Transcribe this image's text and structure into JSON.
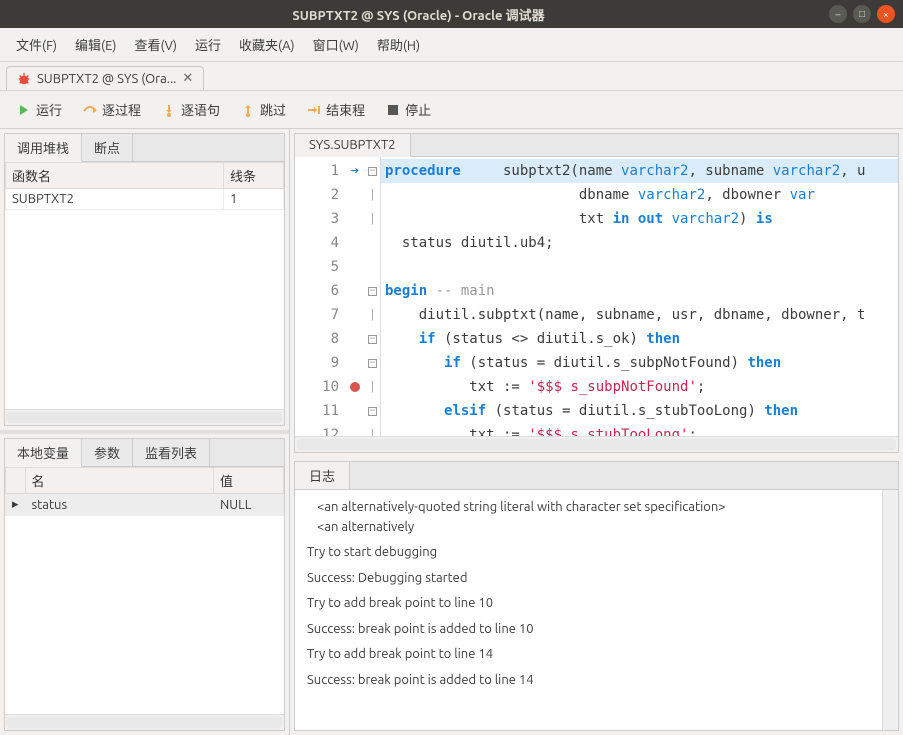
{
  "window": {
    "title": "SUBPTXT2 @ SYS (Oracle) - Oracle 调试器"
  },
  "menu": {
    "file": "文件(F)",
    "edit": "编辑(E)",
    "view": "查看(V)",
    "run": "运行",
    "bookmarks": "收藏夹(A)",
    "window": "窗口(W)",
    "help": "帮助(H)"
  },
  "doc_tab": {
    "label": "SUBPTXT2 @ SYS (Ora..."
  },
  "toolbar": {
    "run": "运行",
    "step_over": "逐过程",
    "step_into": "逐语句",
    "step_out": "跳过",
    "stop": "结束程",
    "pause": "停止"
  },
  "call_stack": {
    "tab_stack": "调用堆栈",
    "tab_breakpoints": "断点",
    "col_func": "函数名",
    "col_line": "线条",
    "rows": [
      {
        "func": "SUBPTXT2",
        "line": "1"
      }
    ]
  },
  "locals": {
    "tab_local": "本地变量",
    "tab_params": "参数",
    "tab_watch": "监看列表",
    "col_name": "名",
    "col_value": "值",
    "rows": [
      {
        "name": "status",
        "value": "NULL"
      }
    ]
  },
  "editor": {
    "tab": "SYS.SUBPTXT2"
  },
  "log": {
    "tab": "日志",
    "lines": [
      "<an alternatively-quoted string literal with character set specification>",
      "<an alternatively",
      "",
      "Try to start debugging",
      "",
      "Success: Debugging started",
      "",
      "Try to add break point to line 10",
      "",
      "Success: break point is added to line 10",
      "",
      "Try to add break point to line 14",
      "",
      "Success: break point is added to line 14"
    ]
  }
}
